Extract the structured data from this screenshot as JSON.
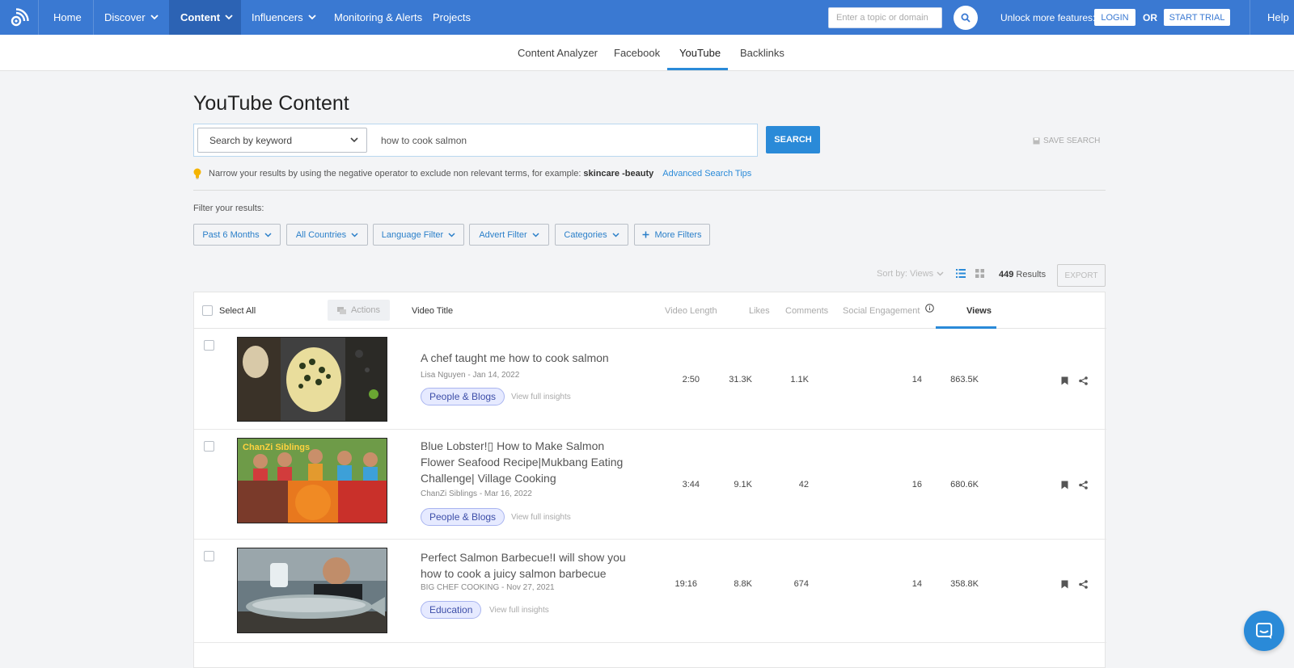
{
  "colors": {
    "nav_bg": "#3a79d2",
    "accent": "#2a8ad8",
    "category_badge_bg": "#e6eaff"
  },
  "topnav": {
    "logo_icon": "rss-broadcast-icon",
    "items": [
      {
        "label": "Home"
      },
      {
        "label": "Discover"
      },
      {
        "label": "Content"
      },
      {
        "label": "Influencers"
      },
      {
        "label": "Monitoring & Alerts"
      },
      {
        "label": "Projects"
      }
    ],
    "topic_placeholder": "Enter a topic or domain",
    "unlock_text": "Unlock more features:",
    "login_label": "LOGIN",
    "or_text": "OR",
    "start_trial_label": "START TRIAL",
    "help_label": "Help"
  },
  "subnav": {
    "tabs": [
      {
        "label": "Content Analyzer"
      },
      {
        "label": "Facebook"
      },
      {
        "label": "YouTube"
      },
      {
        "label": "Backlinks"
      }
    ],
    "active": "YouTube"
  },
  "page": {
    "title": "YouTube Content",
    "search_mode": "Search by keyword",
    "search_query": "how to cook salmon",
    "search_button": "SEARCH",
    "save_search": "SAVE SEARCH",
    "tip_text": "Narrow your results by using the negative operator to exclude non relevant terms, for example:",
    "tip_example": "skincare -beauty",
    "tip_link": "Advanced Search Tips",
    "filter_label": "Filter your results:",
    "filters": [
      {
        "label": "Past 6 Months"
      },
      {
        "label": "All Countries"
      },
      {
        "label": "Language Filter"
      },
      {
        "label": "Advert Filter"
      },
      {
        "label": "Categories"
      },
      {
        "label": "More Filters"
      }
    ],
    "sort_label": "Sort by: Views",
    "results_count": "449",
    "results_label": "Results",
    "export_label": "EXPORT"
  },
  "table": {
    "headers": {
      "select_all": "Select All",
      "actions": "Actions",
      "video_title": "Video Title",
      "video_length": "Video Length",
      "likes": "Likes",
      "comments": "Comments",
      "social_engagement": "Social Engagement",
      "views": "Views"
    },
    "rows": [
      {
        "title": "A chef taught me how to cook salmon",
        "meta": "Lisa Nguyen - Jan 14, 2022",
        "category": "People & Blogs",
        "insights": "View full insights",
        "length": "2:50",
        "likes": "31.3K",
        "comments": "1.1K",
        "engagement": "14",
        "views": "863.5K"
      },
      {
        "title": "Blue Lobster!▯ How to Make Salmon Flower Seafood Recipe|Mukbang Eating Challenge| Village Cooking",
        "meta": "ChanZi Siblings - Mar 16, 2022",
        "category": "People & Blogs",
        "insights": "View full insights",
        "length": "3:44",
        "likes": "9.1K",
        "comments": "42",
        "engagement": "16",
        "views": "680.6K",
        "thumb_text": "ChanZi Siblings"
      },
      {
        "title": "Perfect Salmon Barbecue!I will show you how to cook a juicy salmon barbecue",
        "meta": "BIG CHEF COOKING - Nov 27, 2021",
        "category": "Education",
        "insights": "View full insights",
        "length": "19:16",
        "likes": "8.8K",
        "comments": "674",
        "engagement": "14",
        "views": "358.8K"
      }
    ]
  }
}
